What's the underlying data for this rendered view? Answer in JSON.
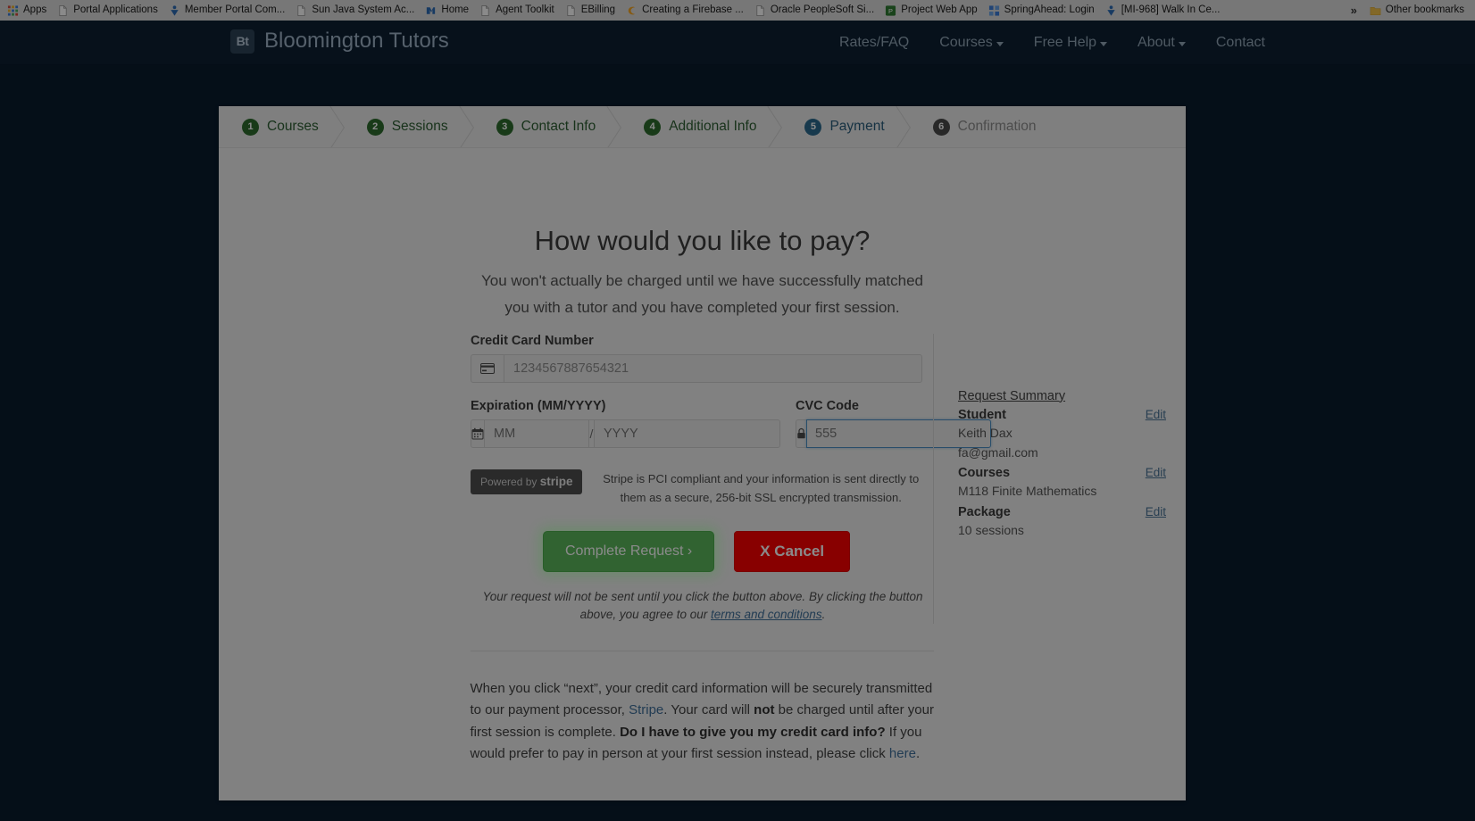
{
  "browser": {
    "bookmarks": [
      {
        "label": "Apps",
        "icon": "apps-grid-icon"
      },
      {
        "label": "Portal Applications",
        "icon": "page-icon"
      },
      {
        "label": "Member Portal Com...",
        "icon": "person-icon"
      },
      {
        "label": "Sun Java System Ac...",
        "icon": "page-icon"
      },
      {
        "label": "Home",
        "icon": "home-icon"
      },
      {
        "label": "Agent Toolkit",
        "icon": "page-icon"
      },
      {
        "label": "EBilling",
        "icon": "page-icon"
      },
      {
        "label": "Creating a Firebase ...",
        "icon": "firebase-icon"
      },
      {
        "label": "Oracle PeopleSoft Si...",
        "icon": "page-icon"
      },
      {
        "label": "Project Web App",
        "icon": "project-icon"
      },
      {
        "label": "SpringAhead: Login",
        "icon": "grid-icon"
      },
      {
        "label": "[MI-968] Walk In Ce...",
        "icon": "person-icon"
      }
    ],
    "overflow_label": "»",
    "other_bookmarks": "Other bookmarks"
  },
  "header": {
    "logo_text": "Bt",
    "brand": "Bloomington Tutors",
    "nav": [
      {
        "label": "Rates/FAQ",
        "caret": false
      },
      {
        "label": "Courses",
        "caret": true
      },
      {
        "label": "Free Help",
        "caret": true
      },
      {
        "label": "About",
        "caret": true
      },
      {
        "label": "Contact",
        "caret": false
      }
    ]
  },
  "wizard": {
    "steps": [
      {
        "num": "1",
        "label": "Courses",
        "state": "done"
      },
      {
        "num": "2",
        "label": "Sessions",
        "state": "done"
      },
      {
        "num": "3",
        "label": "Contact Info",
        "state": "done"
      },
      {
        "num": "4",
        "label": "Additional Info",
        "state": "done"
      },
      {
        "num": "5",
        "label": "Payment",
        "state": "active"
      },
      {
        "num": "6",
        "label": "Confirmation",
        "state": "inactive"
      }
    ]
  },
  "payment": {
    "headline": "How would you like to pay?",
    "subhead": "You won't actually be charged until we have successfully matched you with a tutor and you have completed your first session.",
    "card_label": "Credit Card Number",
    "card_placeholder": "1234567887654321",
    "card_value": "",
    "card_icon": "credit-card-icon",
    "exp_label": "Expiration (MM/YYYY)",
    "exp_icon": "calendar-icon",
    "exp_mm_placeholder": "MM",
    "exp_mm_value": "",
    "exp_separator": "/",
    "exp_yyyy_placeholder": "YYYY",
    "exp_yyyy_value": "",
    "cvc_label": "CVC Code",
    "cvc_icon": "lock-icon",
    "cvc_placeholder": "555",
    "cvc_value": "",
    "stripe_badge_prefix": "Powered by",
    "stripe_badge_name": "stripe",
    "stripe_note": "Stripe is PCI compliant and your information is sent directly to them as a secure, 256-bit SSL encrypted transmission.",
    "complete_label": "Complete Request ›",
    "cancel_label": "X Cancel",
    "disclaimer_part1": "Your request will not be sent until you click the button above. By clicking the button above, you agree to our ",
    "disclaimer_link": "terms and conditions",
    "disclaimer_part2": ".",
    "footnote": {
      "p1": "When you click “next”, your credit card information will be securely transmitted to our payment processor, ",
      "link1": "Stripe",
      "p2": ". Your card will ",
      "b1": "not",
      "p3": " be charged until after your first session is complete. ",
      "b2": "Do I have to give you my credit card info?",
      "p4": " If you would prefer to pay in person at your first session instead, please click ",
      "link2": "here",
      "p5": "."
    }
  },
  "summary": {
    "title": "Request Summary",
    "edit_label": "Edit",
    "rows": [
      {
        "head": "Student",
        "values": [
          "Keith Dax",
          "fa@gmail.com"
        ],
        "edit": true
      },
      {
        "head": "Courses",
        "values": [
          "M118 Finite Mathematics"
        ],
        "edit": true
      },
      {
        "head": "Package",
        "values": [
          "10 sessions"
        ],
        "edit": true
      }
    ]
  },
  "colors": {
    "header_bg": "#0d2033",
    "page_bg": "#0a1c2e",
    "step_done": "#2d6b2d",
    "step_active": "#2b6a8f",
    "step_inactive": "#4a4a4a",
    "complete_btn": "#5cb85c",
    "cancel_btn": "#fb0000",
    "link": "#3f6f9a"
  }
}
